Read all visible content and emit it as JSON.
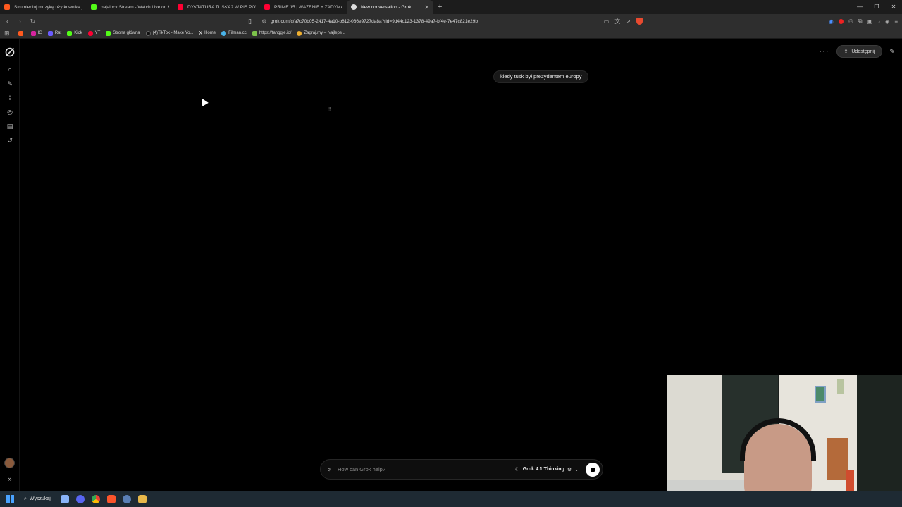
{
  "browser": {
    "tabs": [
      {
        "title": "Strumieniuj muzykę użytkownika jm...",
        "favicon_color": "#ff5a1f"
      },
      {
        "title": "pajalock Stream - Watch Live on Kick",
        "favicon_color": "#53fc18"
      },
      {
        "title": "DYKTATURA TUSKA? W PIS POWARI...",
        "favicon_color": "#ff0033"
      },
      {
        "title": "PRIME 15 | WAŻENIE + ZADYMA - Yo...",
        "favicon_color": "#ff0033"
      },
      {
        "title": "New conversation - Grok",
        "favicon_color": "#dddddd",
        "active": true
      }
    ],
    "new_tab": "+",
    "url": "grok.com/c/a7c70b05-2417-4a10-b812-066e9727da8a?rid=9d44c123-1378-49a7-bf4e-7e47c821e29b",
    "bookmarks": [
      {
        "label": "",
        "color": "#ff5a1f"
      },
      {
        "label": "IG",
        "color": "#d6249f"
      },
      {
        "label": "Rat",
        "color": "#6b5cff"
      },
      {
        "label": "Kick",
        "color": "#53fc18"
      },
      {
        "label": "YT",
        "color": "#ff0033"
      },
      {
        "label": "Strona główna",
        "color": "#53fc18"
      },
      {
        "label": "(4)TikTok - Make Yo...",
        "color": "#111111"
      },
      {
        "label": "Home",
        "color": "#ffffff"
      },
      {
        "label": "Filman.cc",
        "color": "#4ab3e8"
      },
      {
        "label": "https://tanggle.io/",
        "color": "#7cc24a"
      },
      {
        "label": "Zagraj.my – Najleps...",
        "color": "#f0b030"
      }
    ]
  },
  "header": {
    "share_label": "Udostępnij"
  },
  "conversation": {
    "user_message": "kiedy tusk był prezydentem europy",
    "loading": "⁝⁝"
  },
  "composer": {
    "placeholder": "How can Grok help?",
    "model": "Grok 4.1 Thinking"
  },
  "taskbar": {
    "search_label": "Wyszukaj"
  }
}
